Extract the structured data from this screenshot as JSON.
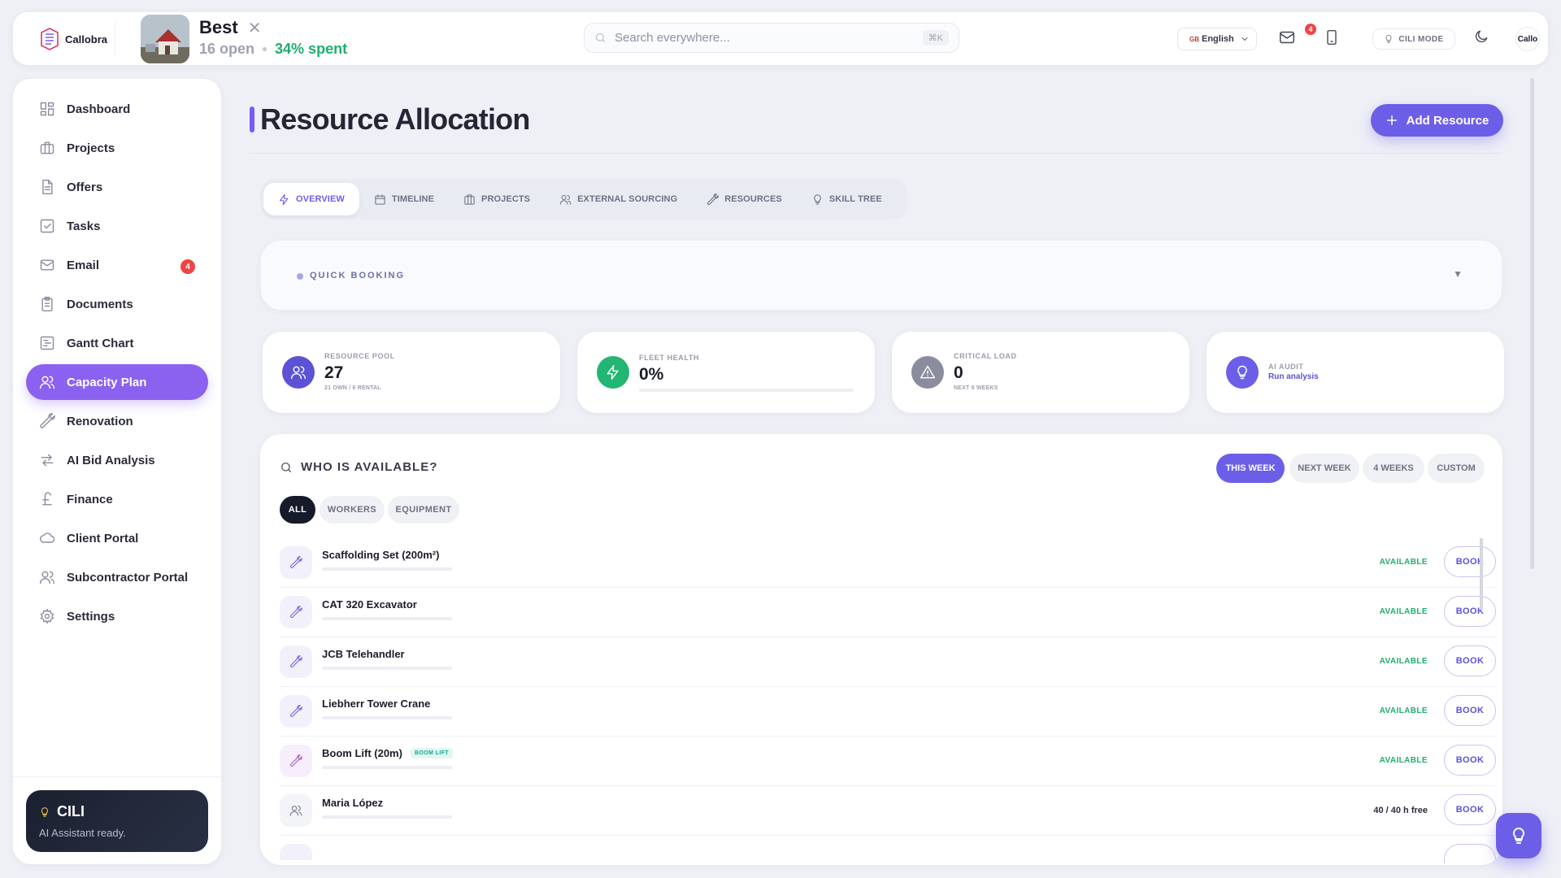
{
  "colors": {
    "accent": "#6d5ee8",
    "sidebar_active": "#8b62f0",
    "success": "#1fae6d",
    "danger": "#ef4444",
    "ai_audit": "#6d5ee8",
    "resource_pool": "#5b52d6",
    "fleet_health": "#22b573",
    "critical_load": "#8a8d9d"
  },
  "topbar": {
    "logo_text": "Callobra",
    "project": {
      "name": "Best",
      "open_text": "16 open",
      "spent_text": "34% spent"
    },
    "search_placeholder": "Search everywhere...",
    "search_shortcut": "⌘K",
    "language": "English",
    "language_code": "GB",
    "mail_badge": "4",
    "cili_mode_label": "CILI MODE",
    "avatar_text": "Callo"
  },
  "sidebar": {
    "items": [
      {
        "label": "Dashboard",
        "icon": "dashboard-icon"
      },
      {
        "label": "Projects",
        "icon": "briefcase-icon"
      },
      {
        "label": "Offers",
        "icon": "document-icon"
      },
      {
        "label": "Tasks",
        "icon": "checkbox-icon"
      },
      {
        "label": "Email",
        "icon": "mail-icon",
        "badge": "4"
      },
      {
        "label": "Documents",
        "icon": "clipboard-icon"
      },
      {
        "label": "Gantt Chart",
        "icon": "gantt-icon"
      },
      {
        "label": "Capacity Plan",
        "icon": "users-icon",
        "active": true
      },
      {
        "label": "Renovation",
        "icon": "wrench-icon"
      },
      {
        "label": "AI Bid Analysis",
        "icon": "arrows-icon"
      },
      {
        "label": "Finance",
        "icon": "pound-icon"
      },
      {
        "label": "Client Portal",
        "icon": "cloud-icon"
      },
      {
        "label": "Subcontractor Portal",
        "icon": "users-icon"
      },
      {
        "label": "Settings",
        "icon": "gear-icon"
      }
    ],
    "assistant": {
      "title": "CILI",
      "subtitle": "AI Assistant ready."
    }
  },
  "main": {
    "title": "Resource Allocation",
    "add_button": "Add Resource",
    "tabs": [
      {
        "label": "OVERVIEW",
        "icon": "bolt-icon",
        "active": true
      },
      {
        "label": "TIMELINE",
        "icon": "calendar-icon"
      },
      {
        "label": "PROJECTS",
        "icon": "building-icon"
      },
      {
        "label": "EXTERNAL SOURCING",
        "icon": "users-icon"
      },
      {
        "label": "RESOURCES",
        "icon": "wrench-icon"
      },
      {
        "label": "SKILL TREE",
        "icon": "lightbulb-icon"
      }
    ],
    "quick_booking": {
      "label": "QUICK BOOKING",
      "caret": "▼"
    },
    "stats": [
      {
        "label": "RESOURCE POOL",
        "value": "27",
        "sub": "21 OWN / 6 RENTAL",
        "icon": "users-icon"
      },
      {
        "label": "FLEET HEALTH",
        "value": "0%",
        "progress": 0,
        "icon": "bolt-icon"
      },
      {
        "label": "CRITICAL LOAD",
        "value": "0",
        "sub": "NEXT 8 WEEKS",
        "icon": "warning-icon"
      },
      {
        "label": "AI AUDIT",
        "link": "Run analysis",
        "icon": "lightbulb-icon"
      }
    ],
    "availability": {
      "title": "WHO IS AVAILABLE?",
      "periods": [
        {
          "label": "THIS WEEK",
          "active": true
        },
        {
          "label": "NEXT WEEK"
        },
        {
          "label": "4 WEEKS"
        },
        {
          "label": "CUSTOM"
        }
      ],
      "filters": [
        {
          "label": "ALL",
          "active": true
        },
        {
          "label": "WORKERS"
        },
        {
          "label": "EQUIPMENT"
        }
      ],
      "book_label": "BOOK",
      "rows": [
        {
          "name": "Scaffolding Set (200m²)",
          "status": "AVAILABLE",
          "type": "equipment",
          "load": 0
        },
        {
          "name": "CAT 320 Excavator",
          "status": "AVAILABLE",
          "type": "equipment",
          "load": 0
        },
        {
          "name": "JCB Telehandler",
          "status": "AVAILABLE",
          "type": "equipment",
          "load": 0
        },
        {
          "name": "Liebherr Tower Crane",
          "status": "AVAILABLE",
          "type": "equipment",
          "load": 0
        },
        {
          "name": "Boom Lift (20m)",
          "tag": "BOOM LIFT",
          "status": "AVAILABLE",
          "type": "equipment",
          "load": 0
        },
        {
          "name": "Maria López",
          "status": "40 / 40 h free",
          "type": "worker",
          "load": 0
        }
      ]
    }
  }
}
